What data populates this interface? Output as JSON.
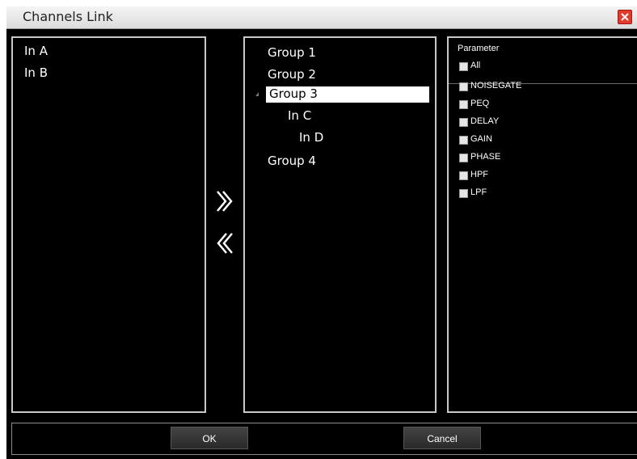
{
  "window": {
    "title": "Channels Link"
  },
  "left_panel": {
    "channels": [
      "In A",
      "In B"
    ]
  },
  "groups_panel": {
    "groups": [
      {
        "label": "Group 1"
      },
      {
        "label": "Group 2"
      },
      {
        "label": "Group 3",
        "selected": true,
        "expanded": true,
        "children": [
          "In C",
          "In D"
        ]
      },
      {
        "label": "Group 4"
      }
    ]
  },
  "transfer": {
    "add_icon": "double-chevron-right-icon",
    "remove_icon": "double-chevron-left-icon"
  },
  "parameter_panel": {
    "title": "Parameter",
    "all_label": "All",
    "items": [
      "NOISEGATE",
      "PEQ",
      "DELAY",
      "GAIN",
      "PHASE",
      "HPF",
      "LPF"
    ]
  },
  "footer": {
    "ok_label": "OK",
    "cancel_label": "Cancel"
  },
  "colors": {
    "background": "#000000",
    "border": "#c8c8c8",
    "close": "#e23a2d"
  }
}
